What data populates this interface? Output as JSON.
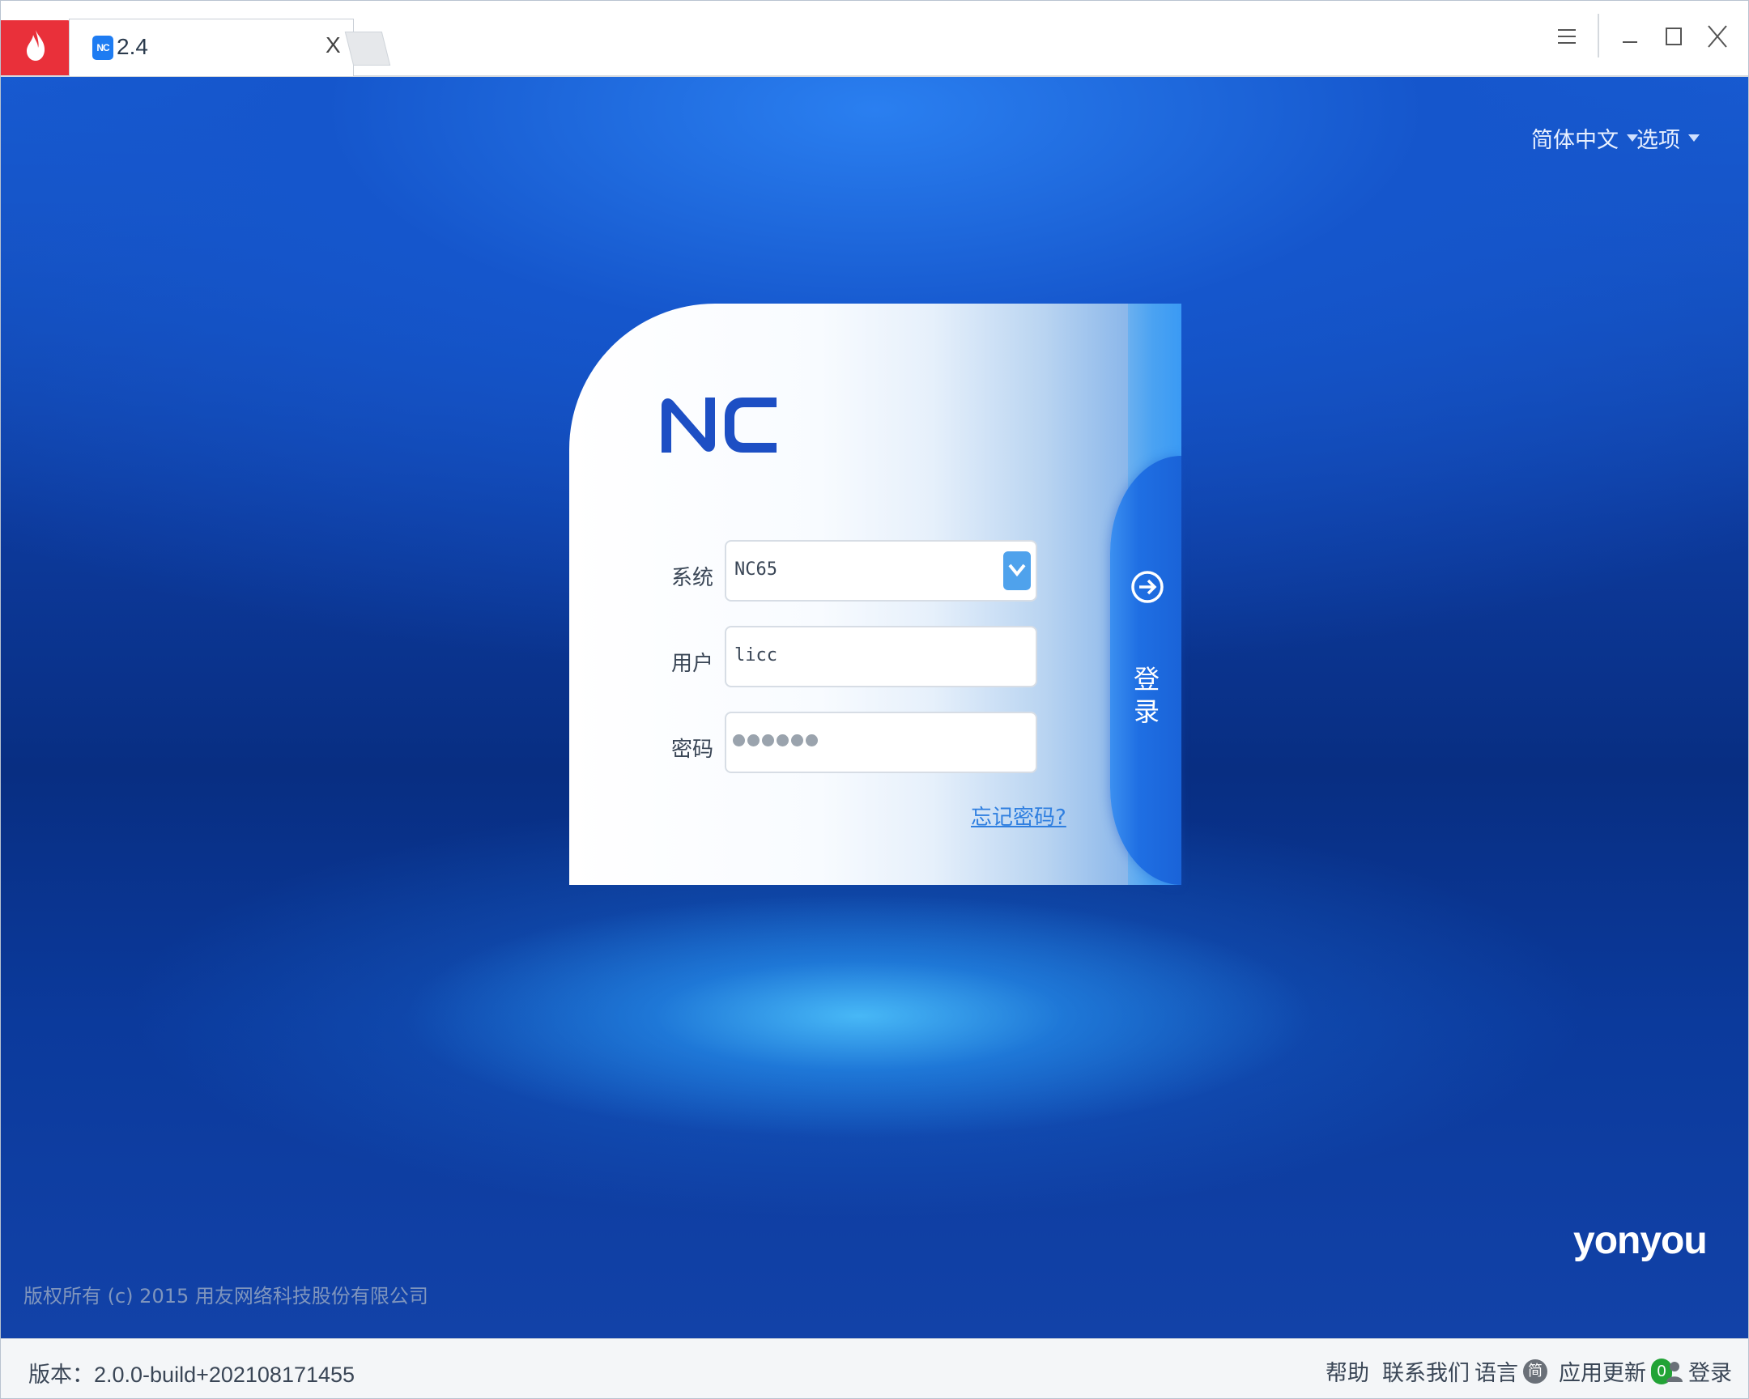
{
  "window": {
    "tab_title": "2.4",
    "tab_close": "X",
    "tab_icon_text": "NC"
  },
  "header": {
    "language": "简体中文",
    "options": "选项"
  },
  "login": {
    "logo_text": "NC",
    "system_label": "系统",
    "system_value": "NC65",
    "user_label": "用户",
    "user_value": "licc",
    "password_label": "密码",
    "password_mask_count": 6,
    "forgot_link": "忘记密码?",
    "login_button": "登录"
  },
  "footer": {
    "brand": "yonyou",
    "copyright": "版权所有 (c) 2015 用友网络科技股份有限公司"
  },
  "statusbar": {
    "version": "版本：2.0.0-build+202108171455",
    "help": "帮助",
    "contact": "联系我们",
    "language": "语言",
    "language_badge": "简",
    "update": "应用更新",
    "update_count": "0",
    "login": "登录"
  },
  "colors": {
    "brand_red": "#e9303a",
    "accent_blue": "#1f6fe3",
    "update_green": "#22a336"
  }
}
